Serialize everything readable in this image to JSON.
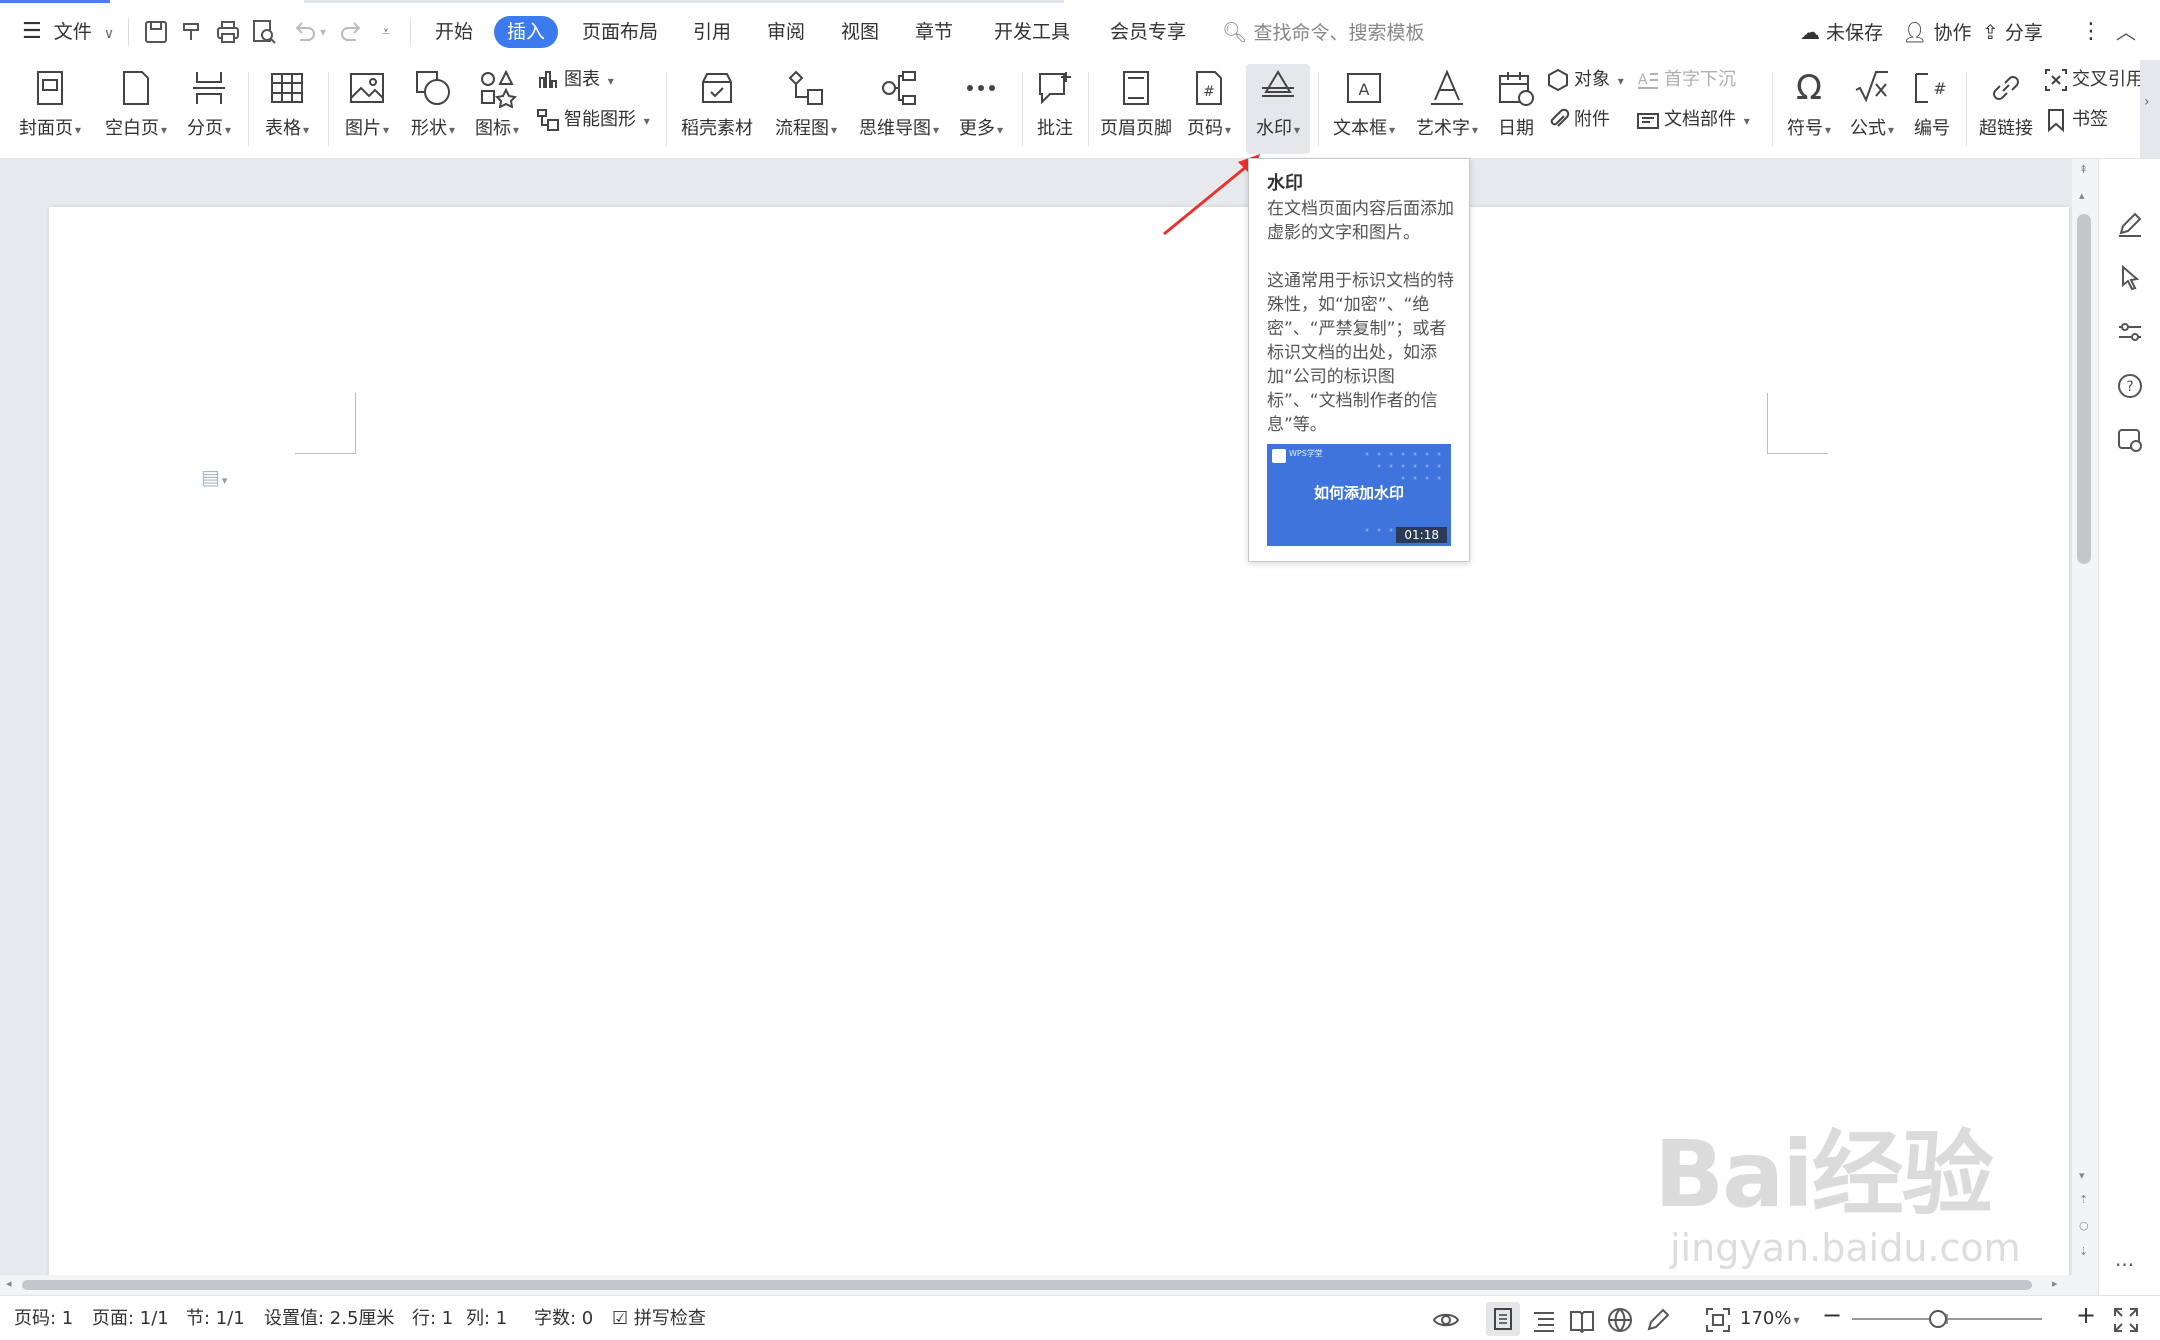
{
  "titlebar": {
    "file_menu": "文件",
    "tabs": [
      "开始",
      "插入",
      "页面布局",
      "引用",
      "审阅",
      "视图",
      "章节",
      "开发工具",
      "会员专享"
    ],
    "active_tab": "插入",
    "search_placeholder": "查找命令、搜索模板",
    "unsaved": "未保存",
    "collab": "协作",
    "share": "分享"
  },
  "ribbon": {
    "cover": "封面页",
    "blank": "空白页",
    "pagebreak": "分页",
    "table": "表格",
    "picture": "图片",
    "shape": "形状",
    "icon": "图标",
    "chart": "图表",
    "smartart": "智能图形",
    "daoke": "稻壳素材",
    "flowchart": "流程图",
    "mindmap": "思维导图",
    "more": "更多",
    "comment": "批注",
    "headerfooter": "页眉页脚",
    "pagenum": "页码",
    "watermark": "水印",
    "textbox": "文本框",
    "wordart": "艺术字",
    "date": "日期",
    "object": "对象",
    "dropcap": "首字下沉",
    "attachment": "附件",
    "docparts": "文档部件",
    "symbol": "符号",
    "equation": "公式",
    "numbering": "编号",
    "hyperlink": "超链接",
    "crossref": "交叉引用",
    "bookmark": "书签"
  },
  "tooltip": {
    "title": "水印",
    "desc": "在文档页面内容后面添加虚影的文字和图片。",
    "detail": "这通常用于标识文档的特殊性，如“加密”、“绝密”、“严禁复制”；或者标识文档的出处，如添加“公司的标识图标”、“文档制作者的信息”等。",
    "video_title": "如何添加水印",
    "video_duration": "01:18",
    "video_logo": "WPS学堂"
  },
  "status": {
    "page_code": "页码: 1",
    "page": "页面: 1/1",
    "section": "节: 1/1",
    "setting": "设置值: 2.5厘米",
    "row": "行: 1",
    "col": "列: 1",
    "wordcount": "字数: 0",
    "spellcheck": "拼写检查",
    "zoom": "170%",
    "zoom_level": 0.45
  },
  "watermark_text": {
    "brand": "Bai经验",
    "url": "jingyan.baidu.com"
  },
  "colors": {
    "accent": "#3c7af0",
    "arrow": "#e8322e",
    "video_bg": "#3f74dc"
  }
}
